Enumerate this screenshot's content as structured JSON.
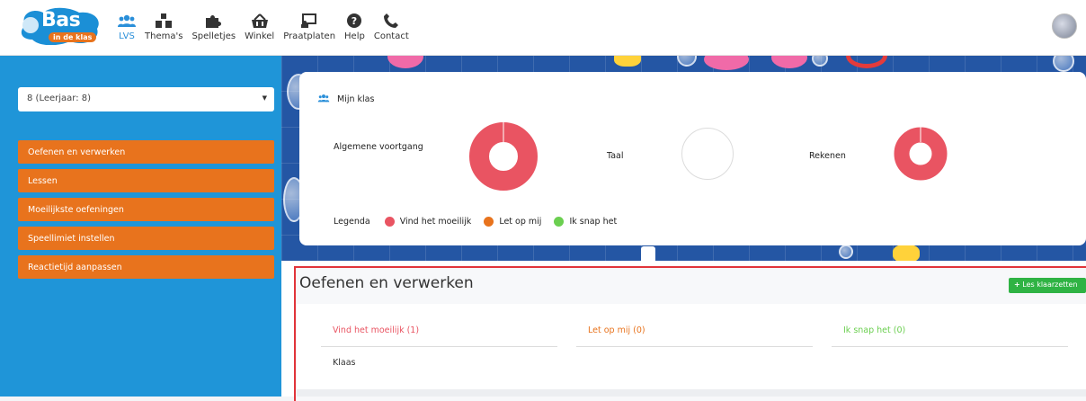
{
  "brand": {
    "name": "Bas",
    "tagline": "in de klas"
  },
  "nav": [
    {
      "label": "LVS",
      "icon": "users-icon",
      "active": true
    },
    {
      "label": "Thema's",
      "icon": "blocks-icon",
      "active": false
    },
    {
      "label": "Spelletjes",
      "icon": "puzzle-icon",
      "active": false
    },
    {
      "label": "Winkel",
      "icon": "basket-icon",
      "active": false
    },
    {
      "label": "Praatplaten",
      "icon": "presentation-icon",
      "active": false
    },
    {
      "label": "Help",
      "icon": "question-icon",
      "active": false
    },
    {
      "label": "Contact",
      "icon": "phone-icon",
      "active": false
    }
  ],
  "sidebar": {
    "class_select": "8 (Leerjaar: 8)",
    "menu": [
      "Oefenen en verwerken",
      "Lessen",
      "Moeilijkste oefeningen",
      "Speellimiet instellen",
      "Reactietijd aanpassen"
    ]
  },
  "card": {
    "title": "Mijn klas",
    "overall_label": "Algemene voortgang",
    "taal_label": "Taal",
    "rekenen_label": "Rekenen",
    "legend_title": "Legenda",
    "legend": [
      {
        "label": "Vind het moeilijk",
        "color": "#e95462"
      },
      {
        "label": "Let op mij",
        "color": "#e8731d"
      },
      {
        "label": "Ik snap het",
        "color": "#6bcf50"
      }
    ],
    "progress": {
      "overall": {
        "hard_fraction": 1.0
      },
      "taal": {
        "hard_fraction": 0
      },
      "rekenen": {
        "hard_fraction": 1.0
      }
    }
  },
  "lower": {
    "title": "Oefenen en verwerken",
    "button": "Les klaarzetten",
    "columns": [
      {
        "label": "Vind het moeilijk (1)",
        "color": "#e95462"
      },
      {
        "label": "Let op mij (0)",
        "color": "#e8731d"
      },
      {
        "label": "Ik snap het (0)",
        "color": "#6bcf50"
      }
    ],
    "student": "Klaas"
  },
  "colors": {
    "accent_blue": "#1f95d8",
    "menu_orange": "#e8731d",
    "success_green": "#2fb344",
    "highlight_red": "#e1343a"
  }
}
